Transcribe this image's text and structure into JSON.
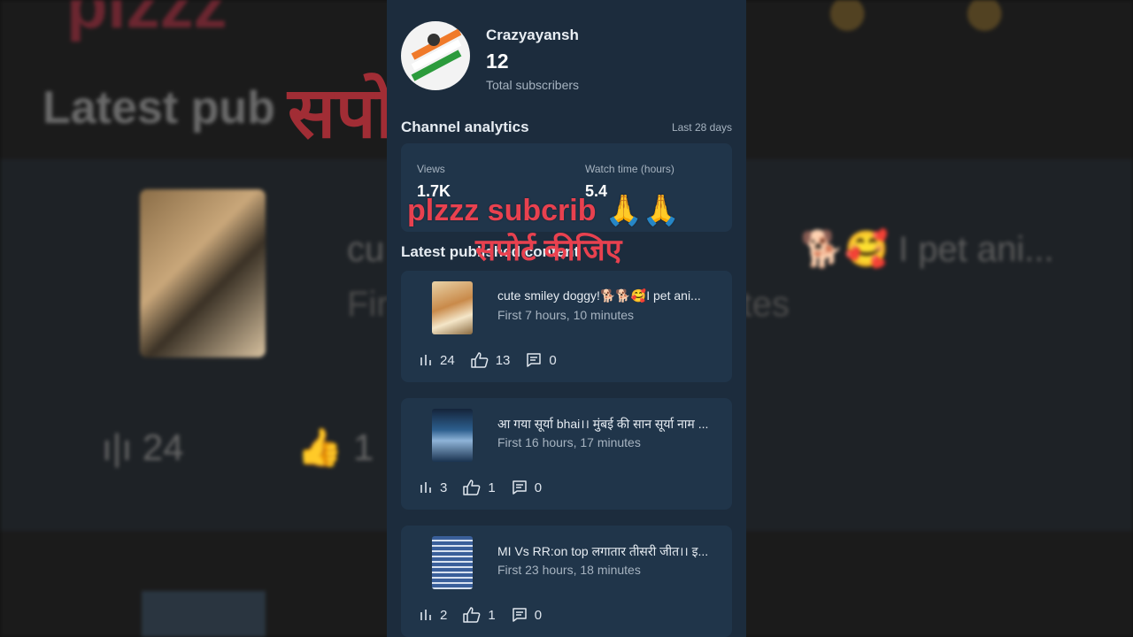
{
  "background": {
    "top_text": "plzzz",
    "title": "Latest pub",
    "line1": "cu",
    "line1_right": "🐕🥰 I pet ani...",
    "line2": "Fir",
    "line2_right": "tes",
    "views": "24",
    "likes": "1",
    "hindi": "सपोर्ट कीजिए"
  },
  "channel": {
    "name": "Crazyayansh",
    "subscriber_count": "12",
    "subscriber_label": "Total subscribers"
  },
  "analytics": {
    "title": "Channel analytics",
    "period": "Last 28 days",
    "views_label": "Views",
    "views_value": "1.7K",
    "watch_label": "Watch time (hours)",
    "watch_value": "5.4"
  },
  "latest": {
    "title": "Latest published content"
  },
  "videos": [
    {
      "title": "cute smiley doggy!🐕🐕🥰I pet ani...",
      "time": "First 7 hours, 10 minutes",
      "views": "24",
      "likes": "13",
      "comments": "0"
    },
    {
      "title": "आ गया सूर्या bhai।। मुंबई की सान सूर्या नाम ...",
      "time": "First 16 hours, 17 minutes",
      "views": "3",
      "likes": "1",
      "comments": "0"
    },
    {
      "title": "MI Vs RR:on top लगातार तीसरी जीत।। इ...",
      "time": "First 23 hours, 18 minutes",
      "views": "2",
      "likes": "1",
      "comments": "0"
    }
  ],
  "overlay": {
    "line1": "plzzz subcrib",
    "pray": "🙏🙏",
    "line2": "सपोर्ट कीजिए"
  },
  "colors": {
    "panel_bg": "#1c2c3d",
    "card_bg": "#20354a",
    "overlay_text": "#e8414f"
  }
}
